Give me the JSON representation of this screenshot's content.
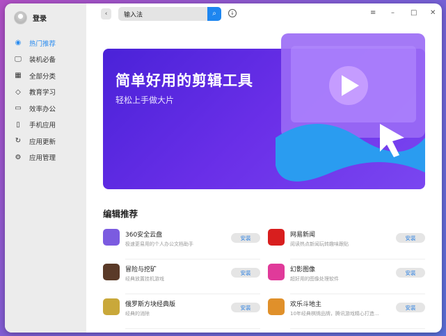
{
  "user": {
    "login": "登录"
  },
  "sidebar": {
    "items": [
      {
        "label": "热门推荐",
        "icon": "fire-icon",
        "active": true
      },
      {
        "label": "装机必备",
        "icon": "monitor-icon"
      },
      {
        "label": "全部分类",
        "icon": "grid-icon"
      },
      {
        "label": "教育学习",
        "icon": "graduation-cap-icon"
      },
      {
        "label": "效率办公",
        "icon": "briefcase-icon"
      },
      {
        "label": "手机应用",
        "icon": "phone-icon"
      },
      {
        "label": "应用更新",
        "icon": "refresh-icon"
      },
      {
        "label": "应用管理",
        "icon": "gear-icon"
      }
    ]
  },
  "search": {
    "value": "输入法"
  },
  "banner": {
    "title": "简单好用的剪辑工具",
    "subtitle": "轻松上手做大片"
  },
  "section": {
    "title": "编辑推荐"
  },
  "apps": [
    {
      "name": "360安全云盘",
      "desc": "极速更易用的个人办公文档助手",
      "install": "安装",
      "color": "#7b5be0"
    },
    {
      "name": "网易新闻",
      "desc": "阅读热点新闻玩转趣味跟贴",
      "install": "安装",
      "color": "#d81e1e"
    },
    {
      "name": "冒险与挖矿",
      "desc": "经典放置挂机游戏",
      "install": "安装",
      "color": "#5a3a28"
    },
    {
      "name": "幻影图像",
      "desc": "超好用的图像处理软件",
      "install": "安装",
      "color": "#e03a9a"
    },
    {
      "name": "俄罗斯方块经典版",
      "desc": "经典的消除",
      "install": "安装",
      "color": "#c9a83a"
    },
    {
      "name": "欢乐斗地主",
      "desc": "10年经典棋牌品牌，腾讯游戏精心打造…",
      "install": "安装",
      "color": "#e0902a"
    }
  ]
}
